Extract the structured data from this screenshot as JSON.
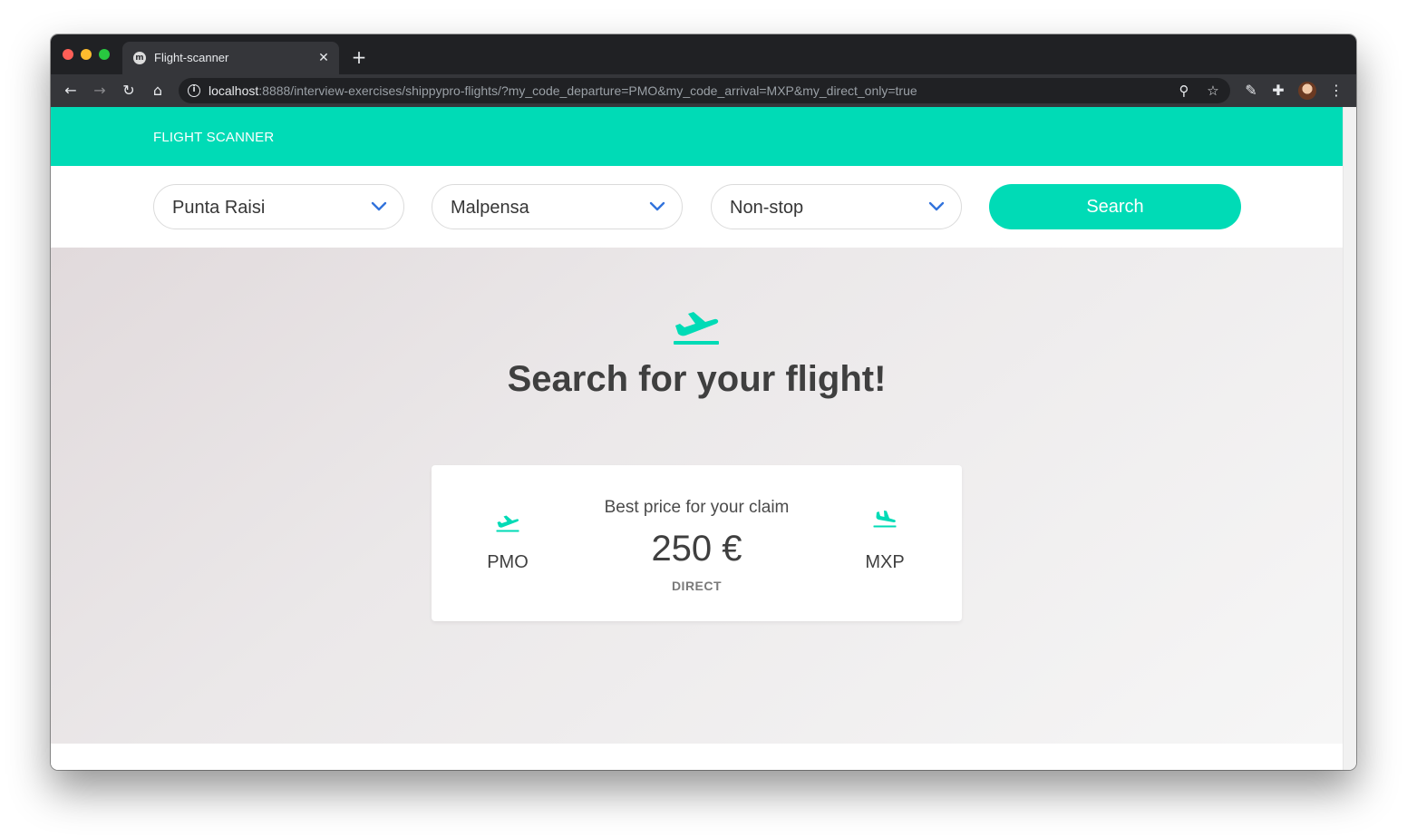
{
  "browser": {
    "tab_title": "Flight-scanner",
    "tab_favicon": "m",
    "tab_close": "✕",
    "new_tab": "+",
    "url_host": "localhost",
    "url_rest": ":8888/interview-exercises/shippypro-flights/?my_code_departure=PMO&my_code_arrival=MXP&my_direct_only=true",
    "icons": {
      "back": "←",
      "forward": "→",
      "reload": "↻",
      "home": "⌂",
      "info": "i",
      "zoom": "⚲",
      "bookmark": "☆",
      "extension": "✎",
      "puzzle": "✚",
      "menu": "⋮"
    }
  },
  "app": {
    "brand": "FLIGHT SCANNER",
    "accent_color": "#00dbb6"
  },
  "search": {
    "departure": "Punta Raisi",
    "arrival": "Malpensa",
    "stops": "Non-stop",
    "button_label": "Search"
  },
  "hero": {
    "title": "Search for your flight!"
  },
  "result": {
    "departure_code": "PMO",
    "arrival_code": "MXP",
    "label": "Best price for your claim",
    "price": "250 €",
    "type": "DIRECT"
  }
}
